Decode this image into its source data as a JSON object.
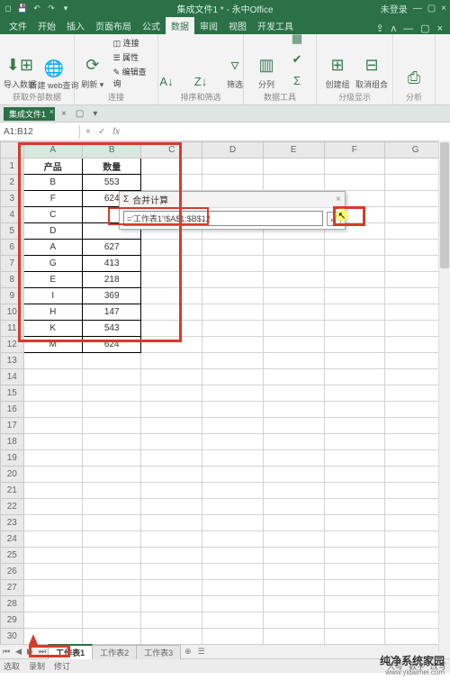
{
  "window": {
    "title_center": "集成文件1 * - 永中Office",
    "login_text": "未登录"
  },
  "ribbon": {
    "tabs": [
      "文件",
      "开始",
      "插入",
      "页面布局",
      "公式",
      "数据",
      "审阅",
      "视图",
      "开发工具"
    ],
    "active_index": 5,
    "groups": {
      "g1": {
        "title": "获取外部数据",
        "btn1": "导入数据",
        "btn2": "新建\nweb查询"
      },
      "g2": {
        "title": "连接",
        "btn_refresh": "刷新 ▾",
        "item1": "◫ 连接",
        "item2": "☰ 属性",
        "item3": "✎ 编辑查询"
      },
      "g3": {
        "title": "排序和筛选",
        "btn_filter": "筛选"
      },
      "g4": {
        "title": "数据工具",
        "btn_text2col": "分列"
      },
      "g5": {
        "title": "分级显示",
        "btn_group": "创建组",
        "btn_ungroup": "取消组合"
      },
      "g6": {
        "title": "分析"
      }
    }
  },
  "doc_tab": "集成文件1",
  "formula": {
    "namebox": "A1:B12",
    "input": ""
  },
  "dialog": {
    "title_icon": "Σ",
    "title": "合并计算",
    "ref_value": "='工作表1'!$A$1:$B$12"
  },
  "sheet": {
    "columns": [
      "A",
      "B",
      "C",
      "D",
      "E",
      "F",
      "G"
    ],
    "header_row": {
      "A": "产品",
      "B": "数量"
    },
    "rows": [
      {
        "A": "B",
        "B": "553"
      },
      {
        "A": "F",
        "B": "624"
      },
      {
        "A": "C",
        "B": ""
      },
      {
        "A": "D",
        "B": ""
      },
      {
        "A": "A",
        "B": "627"
      },
      {
        "A": "G",
        "B": "413"
      },
      {
        "A": "E",
        "B": "218"
      },
      {
        "A": "I",
        "B": "369"
      },
      {
        "A": "H",
        "B": "147"
      },
      {
        "A": "K",
        "B": "543"
      },
      {
        "A": "M",
        "B": "624"
      }
    ],
    "total_rows_shown": 31
  },
  "sheet_tabs": {
    "tabs": [
      "工作表1",
      "工作表2",
      "工作表3"
    ],
    "active_index": 0
  },
  "statusbar": {
    "left": [
      "选取",
      "录制",
      "修订"
    ],
    "right": [
      "大写",
      "数字",
      "改写"
    ]
  },
  "watermark": {
    "line1": "纯净系统家园",
    "line2": "www.yidaimei.com"
  }
}
